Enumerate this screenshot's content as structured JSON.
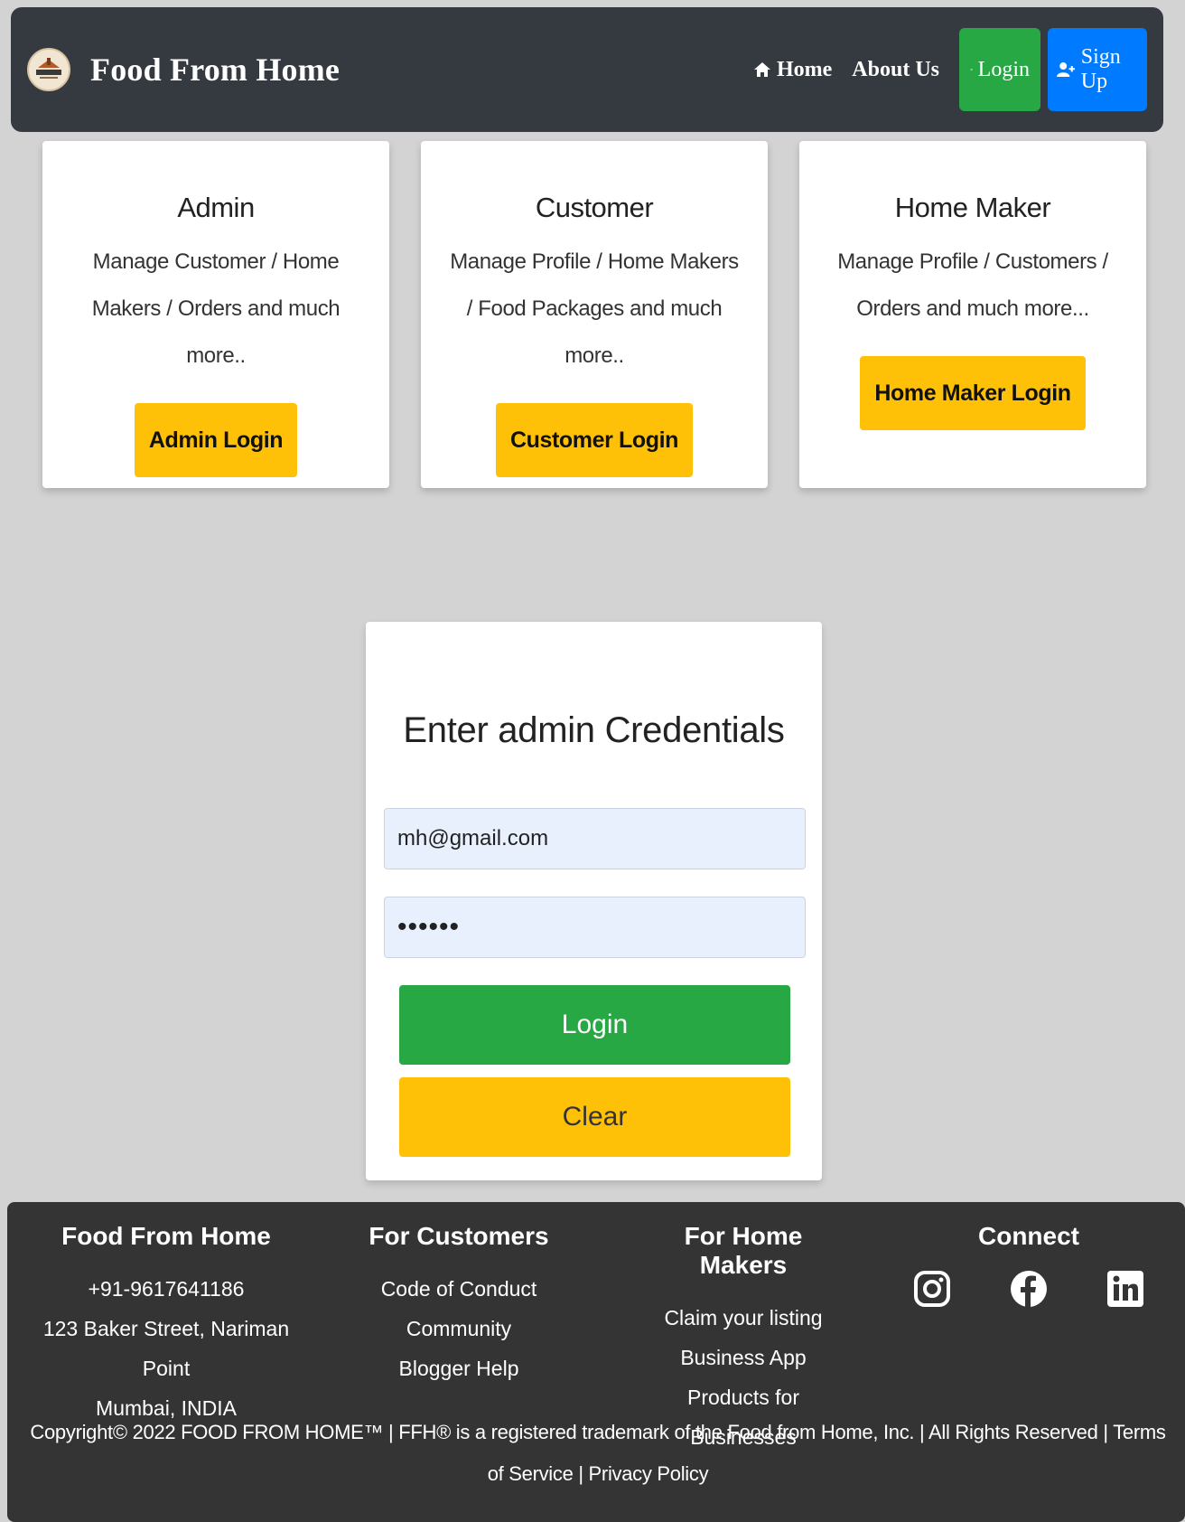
{
  "navbar": {
    "brand": "Food From Home",
    "home": "Home",
    "about": "About Us",
    "login": "Login",
    "signup": "Sign Up"
  },
  "roles": [
    {
      "title": "Admin",
      "description": "Manage Customer / Home Makers / Orders and much more..",
      "button": "Admin Login"
    },
    {
      "title": "Customer",
      "description": "Manage Profile / Home Makers / Food Packages and much more..",
      "button": "Customer Login"
    },
    {
      "title": "Home Maker",
      "description": "Manage Profile / Customers / Orders and much more...",
      "button": "Home Maker Login"
    }
  ],
  "login_form": {
    "heading": "Enter admin Credentials",
    "email_value": "mh@gmail.com",
    "password_value": "••••••",
    "login_button": "Login",
    "clear_button": "Clear"
  },
  "footer": {
    "col1": {
      "title": "Food From Home",
      "lines": [
        "+91-9617641186",
        "123 Baker Street, Nariman Point",
        "Mumbai, INDIA"
      ]
    },
    "col2": {
      "title": "For Customers",
      "lines": [
        "Code of Conduct",
        "Community",
        "Blogger Help"
      ]
    },
    "col3": {
      "title": "For Home Makers",
      "lines": [
        "Claim your listing",
        "Business App",
        "Products for Businesses"
      ]
    },
    "col4": {
      "title": "Connect",
      "icons": [
        "instagram-icon",
        "facebook-icon",
        "linkedin-icon"
      ]
    },
    "copyright": "Copyright© 2022 FOOD FROM HOME™ | FFH® is a registered trademark of the Food from Home, Inc. | All Rights Reserved | Terms of Service | Privacy Policy"
  },
  "colors": {
    "navbar_bg": "#343a40",
    "page_bg": "#d3d3d3",
    "green": "#28a745",
    "blue": "#007bff",
    "yellow": "#ffc107",
    "footer_bg": "#343434"
  }
}
